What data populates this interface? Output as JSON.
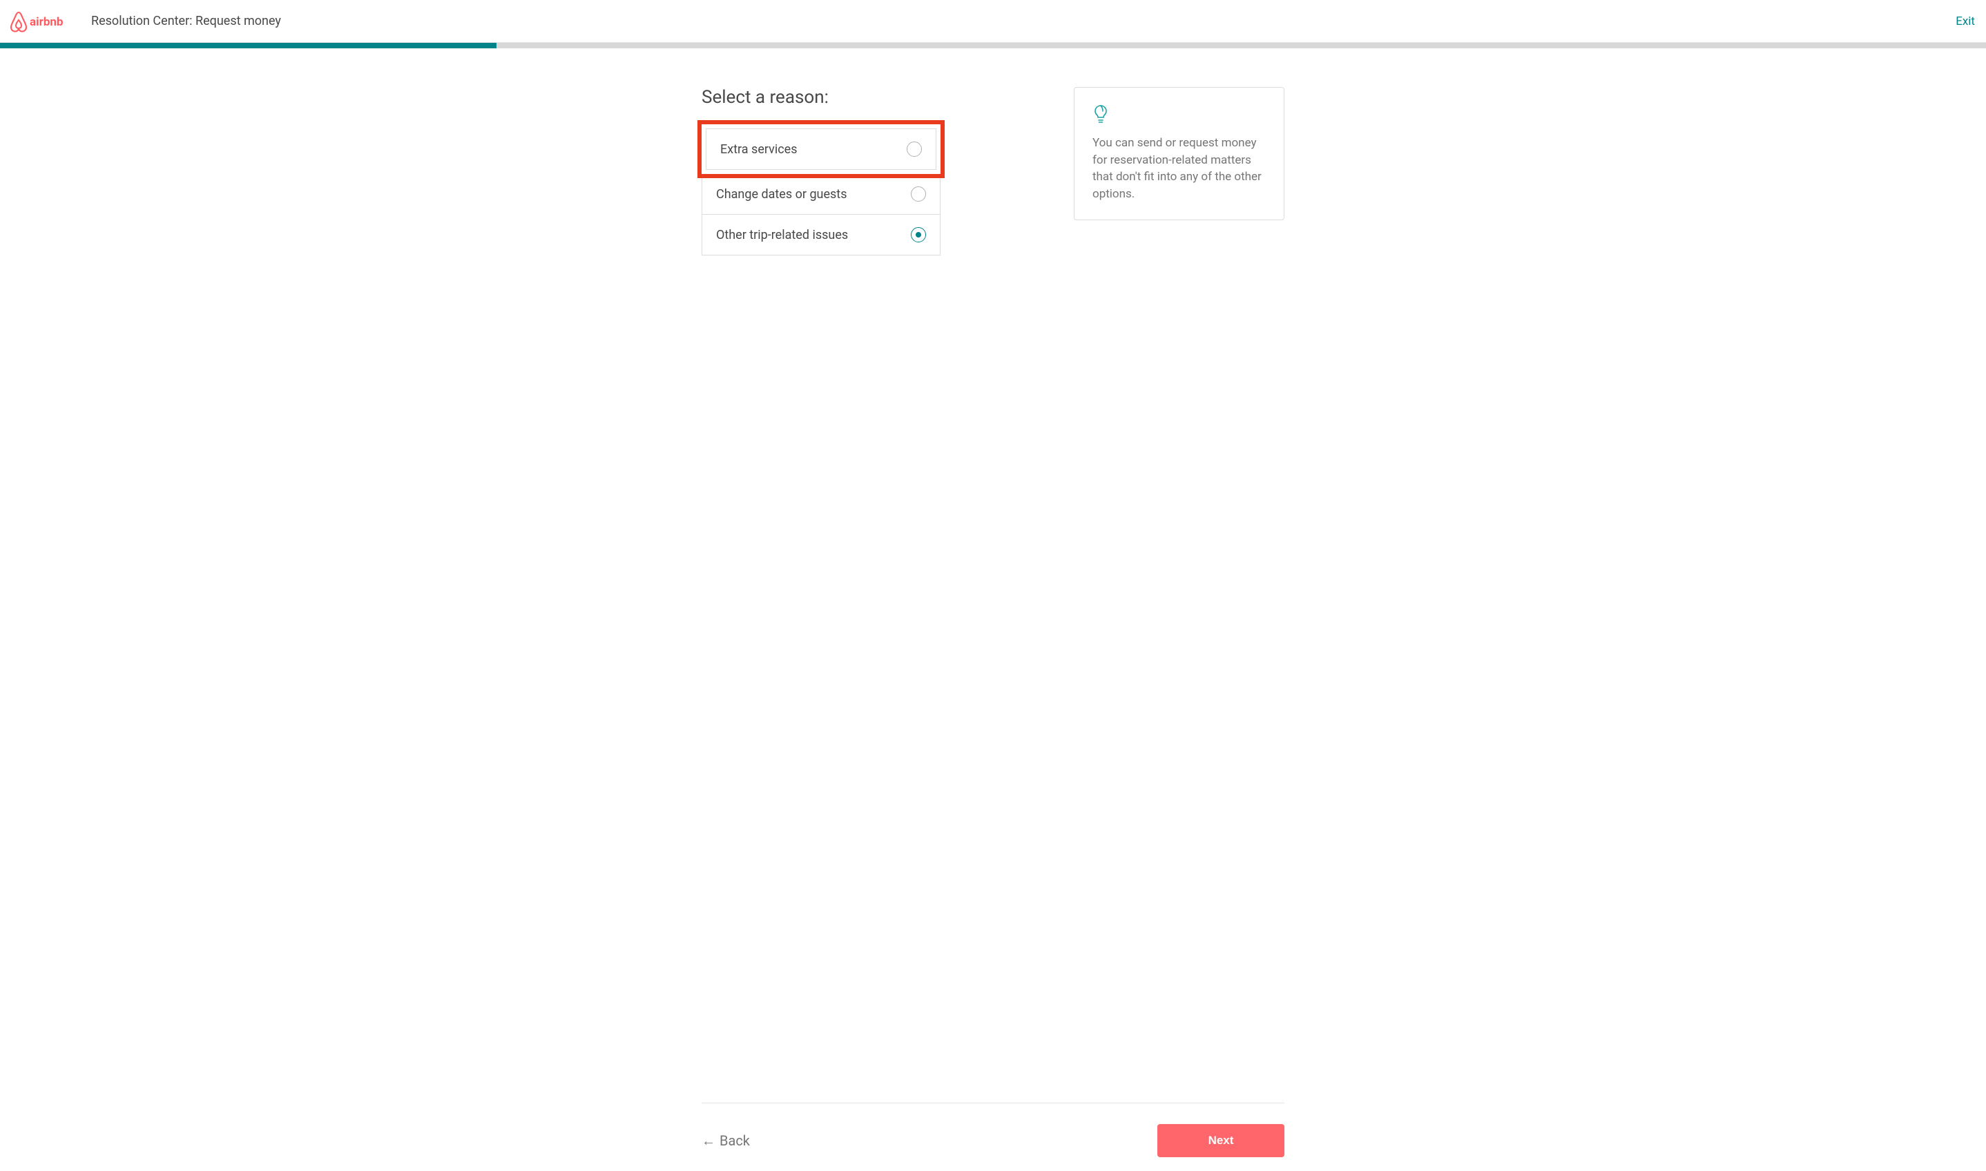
{
  "header": {
    "brand": "airbnb",
    "title": "Resolution Center: Request money",
    "exit_label": "Exit"
  },
  "progress_pct": 25,
  "page": {
    "title": "Select a reason:"
  },
  "reasons": [
    {
      "label": "Extra services",
      "selected": false,
      "highlighted": true
    },
    {
      "label": "Change dates or guests",
      "selected": false,
      "highlighted": false
    },
    {
      "label": "Other trip-related issues",
      "selected": true,
      "highlighted": false
    }
  ],
  "tip": {
    "text": "You can send or request money for reservation-related matters that don't fit into any of the other options."
  },
  "footer": {
    "back_label": "Back",
    "next_label": "Next"
  },
  "colors": {
    "brand": "#ff5a5f",
    "teal": "#008489",
    "highlight": "#e83b1e"
  }
}
